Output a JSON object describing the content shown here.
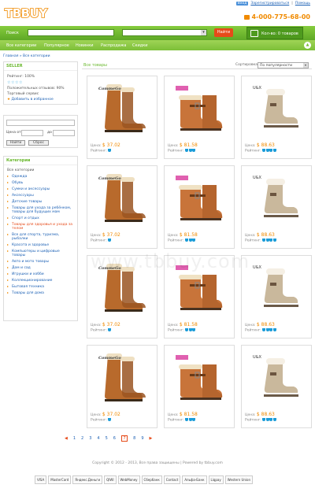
{
  "header": {
    "logo": "TBBUY",
    "top_button": "Вход",
    "top_link_1": "Зарегистрироваться",
    "top_link_2": "Помощь",
    "phone": "4-000-775-68-00"
  },
  "searchbar": {
    "label": "Поиск",
    "search_value": "",
    "category_value": "",
    "find_label": "Найти",
    "cart_label": "Кол-во: 0 товаров"
  },
  "nav": {
    "items": [
      "Все категории",
      "Популярное",
      "Новинки",
      "Распродажа",
      "Скидки"
    ],
    "scroll_icon": "arrow-up-icon"
  },
  "breadcrumb": "Главная » Все категории",
  "seller": {
    "heading": "SELLER",
    "rating_label": "Рейтинг: 100%",
    "stars": "☆☆☆☆",
    "positive": "Положительных отзывов: 90%",
    "service": "Торговый сервис",
    "favorite": "Добавить в избранное"
  },
  "price_filter": {
    "from_label": "Цена от",
    "to_label": "до",
    "find_label": "Найти",
    "reset_label": "Сброс"
  },
  "categories": {
    "heading": "Категории",
    "all_label": "Все категории",
    "items": [
      "Одежда",
      "Обувь",
      "Сумки и аксессуары",
      "Аксессуары",
      "Детские товары",
      "Товары для ухода за ребёнком, товары для будущих мам",
      "Спорт и отдых",
      "Товары для здоровья и ухода за телом",
      "Все для спорта, туризма, рыбалки",
      "Красота и здоровье",
      "Компьютеры и цифровые товары",
      "Авто и мото товары",
      "Дом и сад",
      "Игрушки и хобби",
      "Коллекционирование",
      "Бытовая техника",
      "Товары для дома"
    ],
    "active_index": 7
  },
  "products_header": {
    "title": "Все товары",
    "sort_label": "Сортировка:",
    "sort_value": "По популярности"
  },
  "products": [
    {
      "brand": "CommeGo",
      "price_label": "Цена:",
      "price": "$ 37.02",
      "rating_label": "Рейтинг:",
      "style": "tall",
      "badge": "cs"
    },
    {
      "brand": "",
      "price_label": "Цена:",
      "price": "$ 81.58",
      "rating_label": "Рейтинг:",
      "style": "buckle",
      "badge": "pink"
    },
    {
      "brand": "U&X",
      "price_label": "Цена:",
      "price": "$ 88.63",
      "rating_label": "Рейтинг:",
      "style": "short",
      "badge": "ux"
    },
    {
      "brand": "CommeGo",
      "price_label": "Цена:",
      "price": "$ 37.02",
      "rating_label": "Рейтинг:",
      "style": "tall",
      "badge": "cs"
    },
    {
      "brand": "",
      "price_label": "Цена:",
      "price": "$ 81.58",
      "rating_label": "Рейтинг:",
      "style": "buckle",
      "badge": "pink"
    },
    {
      "brand": "U&X",
      "price_label": "Цена:",
      "price": "$ 88.63",
      "rating_label": "Рейтинг:",
      "style": "short",
      "badge": "ux"
    },
    {
      "brand": "CommeGo",
      "price_label": "Цена:",
      "price": "$ 37.02",
      "rating_label": "Рейтинг:",
      "style": "tall",
      "badge": "cs"
    },
    {
      "brand": "",
      "price_label": "Цена:",
      "price": "$ 81.58",
      "rating_label": "Рейтинг:",
      "style": "buckle",
      "badge": "pink"
    },
    {
      "brand": "U&X",
      "price_label": "Цена:",
      "price": "$ 88.63",
      "rating_label": "Рейтинг:",
      "style": "short",
      "badge": "ux"
    },
    {
      "brand": "CommeGo",
      "price_label": "Цена:",
      "price": "$ 37.02",
      "rating_label": "Рейтинг:",
      "style": "tall",
      "badge": "cs"
    },
    {
      "brand": "",
      "price_label": "Цена:",
      "price": "$ 81.58",
      "rating_label": "Рейтинг:",
      "style": "buckle",
      "badge": "pink"
    },
    {
      "brand": "U&X",
      "price_label": "Цена:",
      "price": "$ 88.63",
      "rating_label": "Рейтинг:",
      "style": "short",
      "badge": "ux"
    }
  ],
  "pagination": {
    "pages": [
      "1",
      "2",
      "3",
      "4",
      "5",
      "6",
      "7",
      "8",
      "9"
    ],
    "current": "7"
  },
  "watermark": "www.tbbuy.com",
  "footer": {
    "copyright": "Copyright © 2012 - 2013, Все права защищены | Powered by tbbuy.com",
    "payments": [
      "VISA",
      "MasterCard",
      "Яндекс.Деньги",
      "QIWI",
      "WebMoney",
      "Сбербанк",
      "Contact",
      "Альфа-Банк",
      "Liqpay",
      "Western Union"
    ]
  },
  "colors": {
    "brand_green": "#6ab82e",
    "accent_orange": "#f08a00",
    "link_blue": "#1a5fb4",
    "find_red": "#e64a19"
  }
}
